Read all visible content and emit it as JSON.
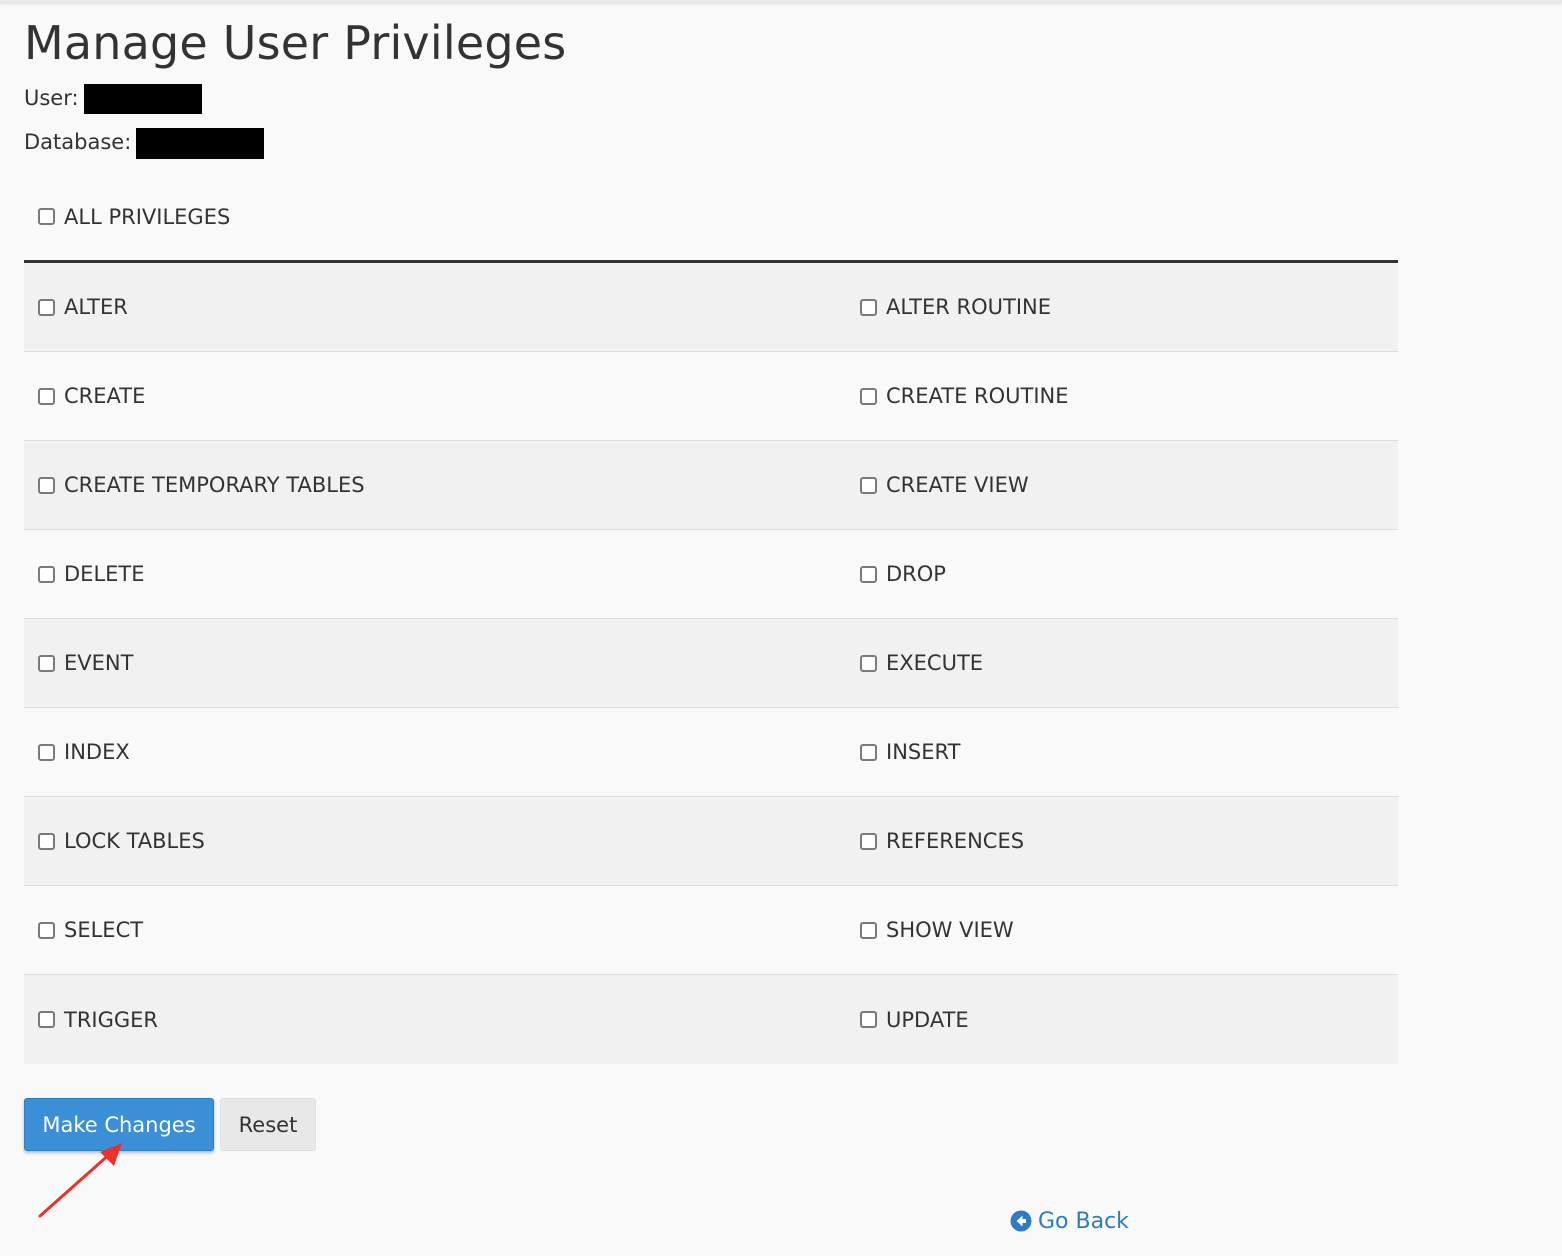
{
  "page": {
    "title": "Manage User Privileges",
    "user_label": "User:",
    "database_label": "Database:"
  },
  "all_privileges": {
    "label": "ALL PRIVILEGES",
    "checked": false
  },
  "privileges": [
    {
      "left": "ALTER",
      "right": "ALTER ROUTINE"
    },
    {
      "left": "CREATE",
      "right": "CREATE ROUTINE"
    },
    {
      "left": "CREATE TEMPORARY TABLES",
      "right": "CREATE VIEW"
    },
    {
      "left": "DELETE",
      "right": "DROP"
    },
    {
      "left": "EVENT",
      "right": "EXECUTE"
    },
    {
      "left": "INDEX",
      "right": "INSERT"
    },
    {
      "left": "LOCK TABLES",
      "right": "REFERENCES"
    },
    {
      "left": "SELECT",
      "right": "SHOW VIEW"
    },
    {
      "left": "TRIGGER",
      "right": "UPDATE"
    }
  ],
  "actions": {
    "make_changes_label": "Make Changes",
    "reset_label": "Reset",
    "go_back_label": "Go Back"
  },
  "icons": {
    "checkbox": "checkbox-unchecked-icon",
    "go_back": "arrow-circle-left-icon",
    "annotation": "red-arrow-icon"
  },
  "colors": {
    "primary_button": "#3b8fd6",
    "link": "#2e7bc4",
    "annotation_arrow": "#e8322a",
    "table_rule": "#333333"
  }
}
